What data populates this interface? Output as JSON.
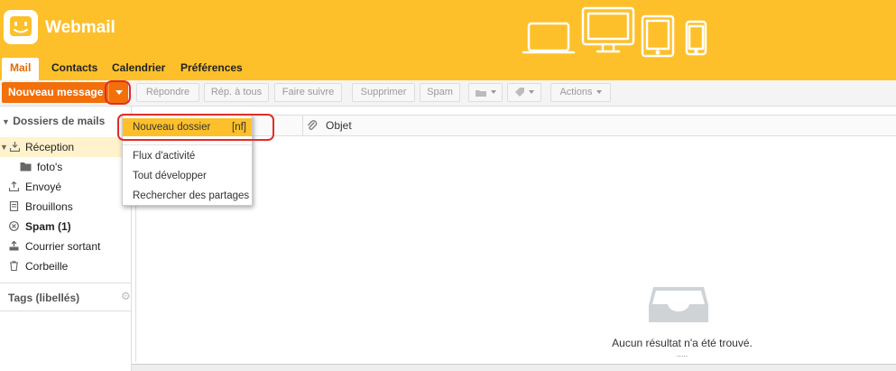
{
  "brand": {
    "title": "Webmail"
  },
  "tabs": [
    {
      "label": "Mail",
      "active": true
    },
    {
      "label": "Contacts"
    },
    {
      "label": "Calendrier"
    },
    {
      "label": "Préférences"
    }
  ],
  "toolbar": {
    "new_message": "Nouveau message",
    "reply": "Répondre",
    "reply_all": "Rép. à tous",
    "forward": "Faire suivre",
    "delete": "Supprimer",
    "spam": "Spam",
    "actions": "Actions"
  },
  "sidebar": {
    "mail_folders_label": "Dossiers de mails",
    "folders": [
      {
        "label": "Réception",
        "icon": "inbox-icon",
        "selected": true
      },
      {
        "label": "foto's",
        "icon": "folder-icon"
      },
      {
        "label": "Envoyé",
        "icon": "sent-icon"
      },
      {
        "label": "Brouillons",
        "icon": "drafts-icon"
      },
      {
        "label": "Spam (1)",
        "icon": "spam-icon",
        "bold": true
      },
      {
        "label": "Courrier sortant",
        "icon": "outbox-icon"
      },
      {
        "label": "Corbeille",
        "icon": "trash-icon"
      }
    ],
    "tags_label": "Tags (libellés)"
  },
  "list": {
    "subject_header": "Objet",
    "empty_text": "Aucun résultat n'a été trouvé.",
    "ellipsis": "....."
  },
  "dropdown": {
    "items": [
      {
        "label": "Nouveau dossier",
        "shortcut": "[nf]",
        "highlighted": true
      },
      {
        "label": "Flux d'activité"
      },
      {
        "label": "Tout développer"
      },
      {
        "label": "Rechercher des partages"
      }
    ]
  },
  "colors": {
    "header": "#fdc02a",
    "accent": "#f26f0a",
    "highlight_ring": "#e12d27"
  }
}
